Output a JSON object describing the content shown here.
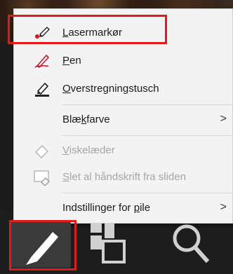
{
  "menu": {
    "items": [
      {
        "id": "laser",
        "pre": "",
        "u": "L",
        "post": "asermarkør",
        "icon": "laser-pointer-icon",
        "disabled": false,
        "submenu": false
      },
      {
        "id": "pen",
        "pre": "",
        "u": "P",
        "post": "en",
        "icon": "pen-icon",
        "disabled": false,
        "submenu": false
      },
      {
        "id": "highlighter",
        "pre": "",
        "u": "O",
        "post": "verstregningstusch",
        "icon": "highlighter-icon",
        "disabled": false,
        "submenu": false
      },
      {
        "id": "ink-color",
        "pre": "Blæ",
        "u": "k",
        "post": "farve",
        "icon": "",
        "disabled": false,
        "submenu": true
      },
      {
        "id": "eraser",
        "pre": "",
        "u": "V",
        "post": "iskelæder",
        "icon": "eraser-icon",
        "disabled": true,
        "submenu": false
      },
      {
        "id": "clear-ink",
        "pre": "",
        "u": "S",
        "post": "let al håndskrift fra sliden",
        "icon": "clear-ink-icon",
        "disabled": true,
        "submenu": false
      },
      {
        "id": "arrow-options",
        "pre": "Indstillinger for ",
        "u": "p",
        "post": "ile",
        "icon": "",
        "disabled": false,
        "submenu": true
      }
    ],
    "chevron": ">"
  },
  "toolbar": {
    "tools": [
      "pen-tool-icon",
      "see-all-slides-icon",
      "zoom-icon"
    ]
  },
  "colors": {
    "highlight": "#e11b1b",
    "laser_red": "#d7191f",
    "pen_red": "#c0182a"
  }
}
